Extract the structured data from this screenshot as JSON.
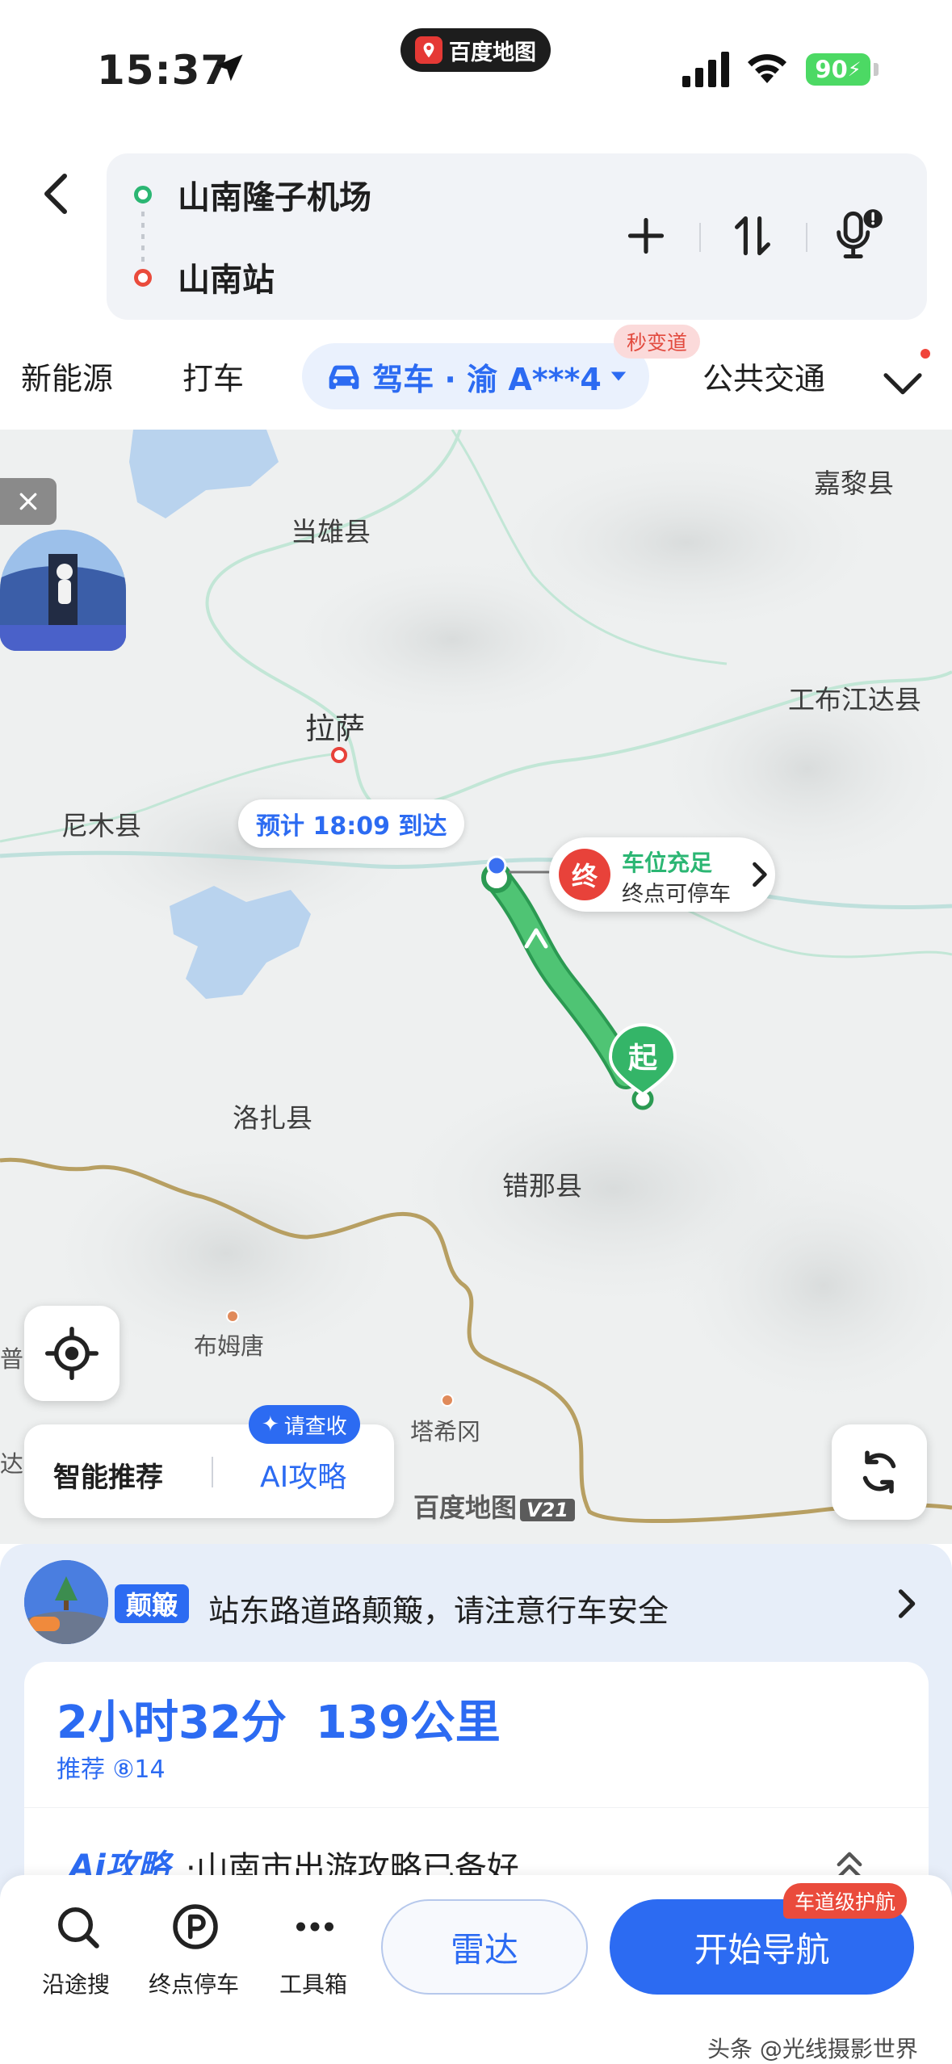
{
  "status_bar": {
    "time": "15:37",
    "app_name": "百度地图",
    "battery": "90"
  },
  "route": {
    "origin": "山南隆子机场",
    "destination": "山南站"
  },
  "mode_tabs": {
    "new_energy": "新能源",
    "taxi": "打车",
    "drive": "驾车 · 渝 A***4",
    "drive_badge": "秒变道",
    "transit": "公共交通"
  },
  "map": {
    "labels": {
      "jiali": "嘉黎县",
      "dangxiong": "当雄县",
      "gongbujiangda": "工布江达县",
      "lasa": "拉萨",
      "nimu": "尼木县",
      "luozha": "洛扎县",
      "cuona": "错那县",
      "bumutang": "布姆唐",
      "taxigang": "塔希冈",
      "edge_pu": "普",
      "edge_da": "达"
    },
    "eta": "预计 18:09 到达",
    "dest_badge": "终",
    "dest_line1": "车位充足",
    "dest_line2": "终点可停车",
    "start_badge": "起",
    "watermark": "百度地图",
    "watermark_version": "V21",
    "smart_recommend": "智能推荐",
    "ai_guide": "AI攻略",
    "checkin_badge": "请查收"
  },
  "sheet": {
    "warn_tag": "颠簸",
    "warn_text": "站东路道路颠簸，请注意行车安全",
    "duration": "2小时32分",
    "distance": "139公里",
    "route_tag": "推荐 ⑧14",
    "ai_brand": "Ai攻略",
    "ai_text": "·山南市出游攻略已备好"
  },
  "toolbar": {
    "search_along": "沿途搜",
    "end_parking": "终点停车",
    "toolbox": "工具箱",
    "radar": "雷达",
    "start_nav": "开始导航",
    "nav_badge": "车道级护航"
  },
  "credit": "头条 @光线摄影世界",
  "colors": {
    "accent": "#2c6bf2",
    "route_green": "#3dbb6a",
    "dest_red": "#e8423a",
    "border_gold": "#b79f62"
  }
}
